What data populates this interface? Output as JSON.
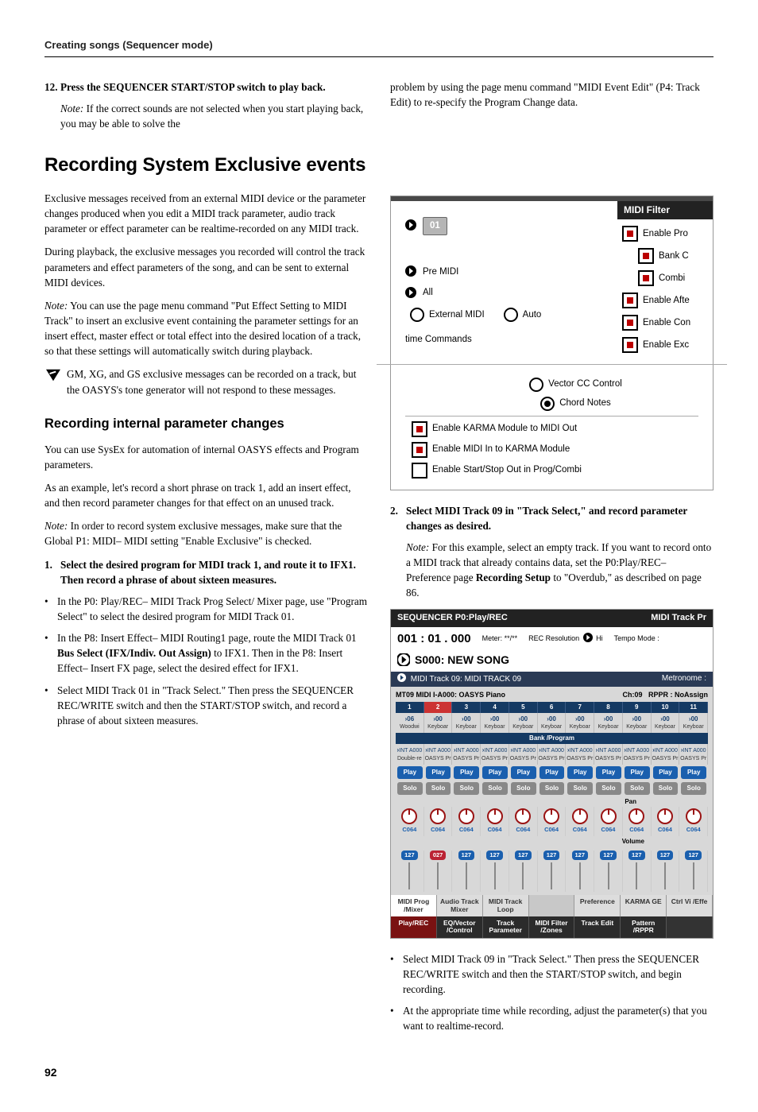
{
  "runhead": "Creating songs (Sequencer mode)",
  "intro": {
    "step12_num": "12.",
    "step12_text": "Press the SEQUENCER START/STOP switch to play back.",
    "note_label": "Note:",
    "note_text_l": " If the correct sounds are not selected when you start playing back, you may be able to solve the",
    "note_text_r": "problem by using the page menu command \"MIDI Event Edit\" (P4: Track Edit) to re-specify the Program Change data."
  },
  "h1": "Recording System Exclusive events",
  "p1": "Exclusive messages received from an external MIDI device or the parameter changes produced when you edit a MIDI track parameter, audio track parameter or effect parameter can be realtime-recorded on any MIDI track.",
  "p2": "During playback, the exclusive messages you recorded will control the track parameters and effect parameters of the song, and can be sent to external MIDI devices.",
  "p3_note_label": "Note:",
  "p3_note": " You can use the page menu command \"Put Effect Setting to MIDI Track\" to insert an exclusive event containing the parameter settings for an insert effect, master effect or total effect into the desired location of a track, so that these settings will automatically switch during playback.",
  "p4": "GM, XG, and GS exclusive messages can be recorded on a track, but the OASYS's tone generator will not respond to these messages.",
  "h2": "Recording internal parameter changes",
  "p5": "You can use SysEx for automation of internal OASYS effects and Program parameters.",
  "p6": "As an example, let's record a short phrase on track 1, add an insert effect, and then record parameter changes for that effect on an unused track.",
  "p7_note_label": "Note:",
  "p7_note": " In order to record system exclusive messages, make sure that the Global P1: MIDI– MIDI setting \"Enable Exclusive\" is checked.",
  "step1_num": "1.",
  "step1": "Select the desired program for MIDI track 1, and route it to IFX1. Then record a phrase of about sixteen measures.",
  "b1": "In the P0: Play/REC– MIDI Track Prog Select/ Mixer page, use \"Program Select\" to select the desired program for MIDI Track 01.",
  "b2a": "In the P8: Insert Effect– MIDI Routing1 page, route the MIDI Track 01 ",
  "b2b": "Bus Select (IFX/Indiv. Out Assign)",
  "b2c": " to IFX1. Then in the P8: Insert Effect– Insert FX page, select the desired effect for IFX1.",
  "b3": "Select MIDI Track 01 in \"Track Select.\" Then press the SEQUENCER REC/WRITE switch and then the START/STOP switch, and record a phrase of about sixteen measures.",
  "step2_num": "2.",
  "step2": "Select MIDI Track 09 in \"Track Select,\" and record parameter changes as desired.",
  "step2_note_label": "Note:",
  "step2_note_a": " For this example, select an empty track. If you want to record onto a MIDI track that already contains data, set the P0:Play/REC– Preference page ",
  "step2_note_b": "Recording Setup",
  "step2_note_c": " to \"Overdub,\" as described on page 86.",
  "b4": "Select MIDI Track 09 in \"Track Select.\" Then press the SEQUENCER REC/WRITE switch and then the START/STOP switch, and begin recording.",
  "b5": "At the appropriate time while recording, adjust the parameter(s) that you want to realtime-record.",
  "shot1": {
    "mf_title": "MIDI Filter",
    "val01": "01",
    "pre_midi": "Pre MIDI",
    "all": "All",
    "ext_midi": "External MIDI",
    "auto": "Auto",
    "time_cmds": "time Commands",
    "enable_pro": "Enable Pro",
    "bank_c": "Bank C",
    "combi": "Combi",
    "enable_afte": "Enable Afte",
    "enable_con": "Enable Con",
    "enable_exc": "Enable Exc",
    "vector": "Vector CC Control",
    "chord": "Chord Notes",
    "karma_out": "Enable KARMA Module to MIDI Out",
    "midi_in": "Enable MIDI In to KARMA Module",
    "startstop": "Enable Start/Stop Out in Prog/Combi"
  },
  "shot2": {
    "title_l": "SEQUENCER P0:Play/REC",
    "title_r": "MIDI Track Pr",
    "time": "001 : 01 . 000",
    "meter": "Meter: **/**",
    "rec_res": "REC Resolution",
    "hi": "Hi",
    "tempo": "Tempo Mode :",
    "song": "S000: NEW SONG",
    "track_l": "MIDI Track 09: MIDI TRACK 09",
    "metronome": "Metronome :",
    "mt_l": "MT09 MIDI I-A000: OASYS Piano",
    "ch": "Ch:09",
    "rppr": "RPPR : NoAssign",
    "nums": [
      "1",
      "2",
      "3",
      "4",
      "5",
      "6",
      "7",
      "8",
      "9",
      "10",
      "11"
    ],
    "cells_00": [
      "06",
      "00",
      "00",
      "00",
      "00",
      "00",
      "00",
      "00",
      "00",
      "00",
      "00"
    ],
    "keybd": "Keyboar",
    "wood": "Woodwi",
    "bp": "Bank /Program",
    "int": "INT A000",
    "oasys": "OASYS Pr",
    "db": "Double-re",
    "play": "Play",
    "solo": "Solo",
    "pan": "Pan",
    "c064": "C064",
    "volume": "Volume",
    "l127": "127",
    "l027": "027",
    "tabs1": [
      "MIDI Prog /Mixer",
      "Audio Track Mixer",
      "MIDI Track Loop",
      "",
      "Preference",
      "KARMA GE",
      "Ctrl Vi /Effe"
    ],
    "tabs2": [
      "Play/REC",
      "EQ/Vector /Control",
      "Track Parameter",
      "MIDI Filter /Zones",
      "Track Edit",
      "Pattern /RPPR",
      ""
    ]
  },
  "pagenum": "92"
}
